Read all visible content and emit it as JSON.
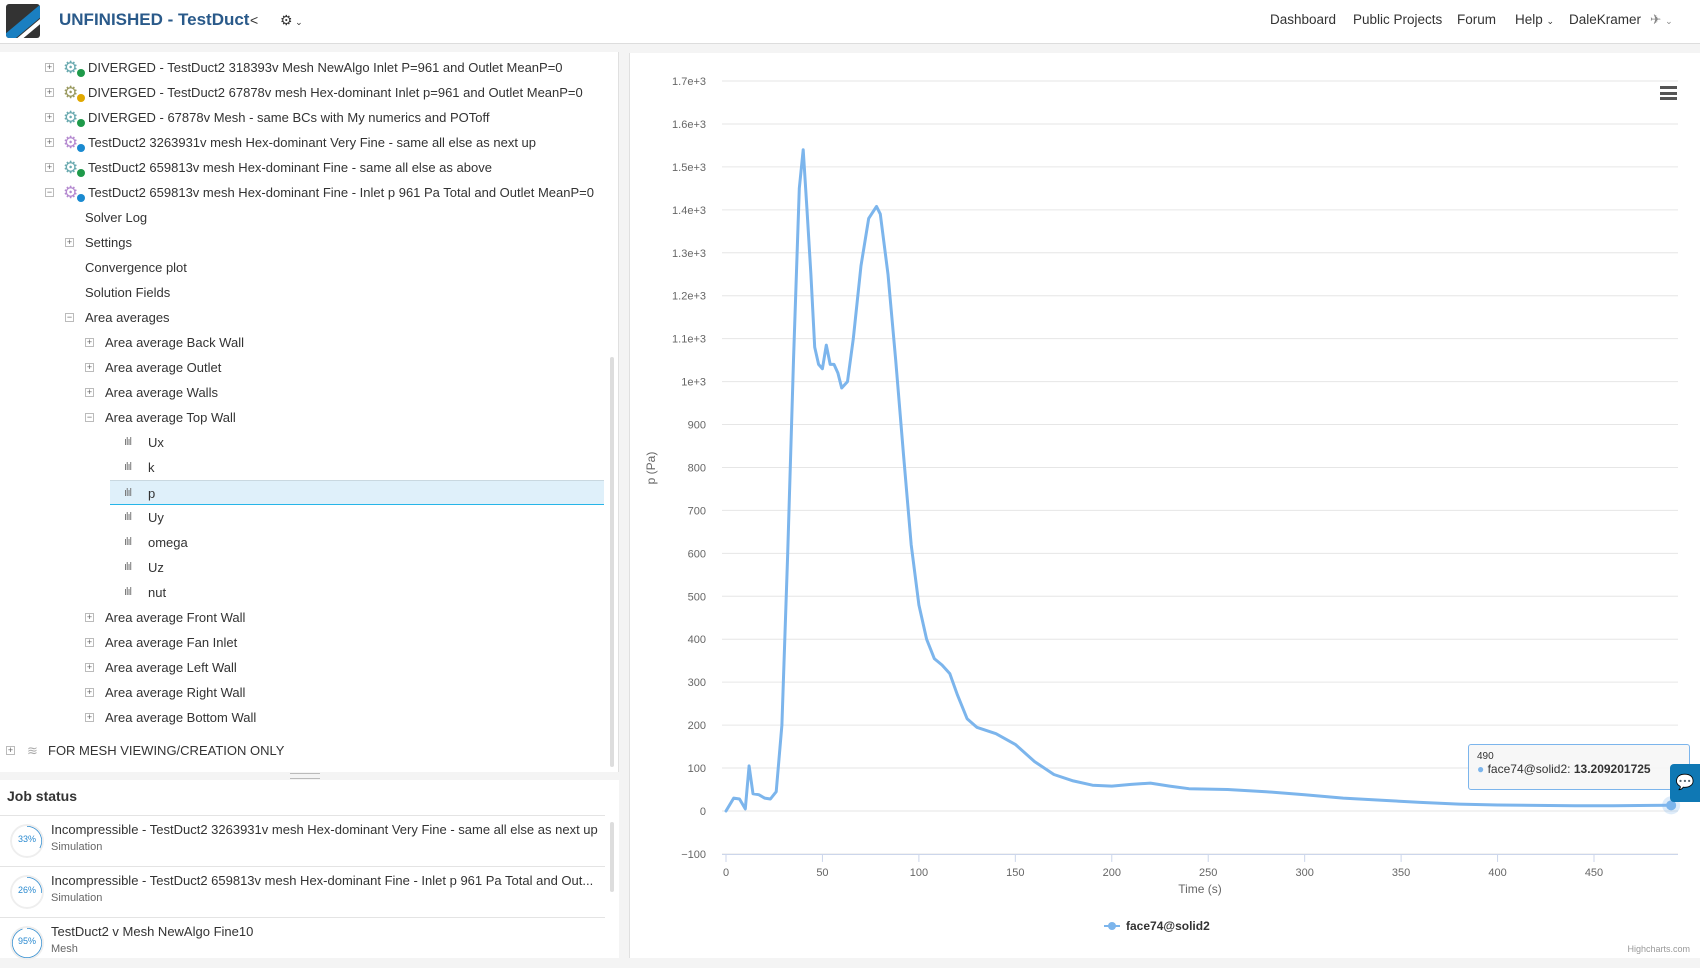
{
  "header": {
    "title": "UNFINISHED - TestDuct",
    "share_icon": "share-icon",
    "settings_icon": "gear-icon",
    "nav": [
      "Dashboard",
      "Public Projects",
      "Forum",
      "Help"
    ],
    "user": "DaleKramer"
  },
  "tree": {
    "simulations": [
      {
        "label": "DIVERGED - TestDuct2 318393v Mesh NewAlgo Inlet P=961 and Outlet MeanP=0",
        "status": "finished",
        "color": "#6aaab0",
        "badge": "#1e9a4a",
        "expanded": false
      },
      {
        "label": "DIVERGED - TestDuct2 67878v mesh Hex-dominant Inlet p=961 and Outlet MeanP=0",
        "status": "warning",
        "color": "#9a9a60",
        "badge": "#e0a800",
        "expanded": false
      },
      {
        "label": "DIVERGED - 67878v Mesh - same BCs with My numerics and POToff",
        "status": "finished",
        "color": "#6aaab0",
        "badge": "#1e9a4a",
        "expanded": false
      },
      {
        "label": "TestDuct2 3263931v mesh Hex-dominant Very Fine - same all else as next up",
        "status": "running",
        "color": "#b58ad0",
        "badge": "#1a8ad0",
        "expanded": false
      },
      {
        "label": "TestDuct2 659813v mesh Hex-dominant Fine - same all else as above",
        "status": "finished",
        "color": "#6aaab0",
        "badge": "#1e9a4a",
        "expanded": false
      },
      {
        "label": "TestDuct2 659813v mesh Hex-dominant Fine - Inlet p 961 Pa Total and Outlet MeanP=0",
        "status": "running",
        "color": "#b58ad0",
        "badge": "#1a8ad0",
        "expanded": true
      }
    ],
    "sim_children": [
      {
        "label": "Solver Log",
        "exp": ""
      },
      {
        "label": "Settings",
        "exp": "+"
      },
      {
        "label": "Convergence plot",
        "exp": ""
      },
      {
        "label": "Solution Fields",
        "exp": ""
      },
      {
        "label": "Area averages",
        "exp": "−"
      }
    ],
    "area_averages_before": [
      "Area average Back Wall",
      "Area average Outlet",
      "Area average Walls"
    ],
    "top_wall": "Area average Top Wall",
    "fields": [
      "Ux",
      "k",
      "p",
      "Uy",
      "omega",
      "Uz",
      "nut"
    ],
    "selected_field": "p",
    "area_averages_after": [
      "Area average Front Wall",
      "Area average Fan Inlet",
      "Area average Left Wall",
      "Area average Right Wall",
      "Area average Bottom Wall"
    ],
    "mesh_folder": "FOR MESH VIEWING/CREATION ONLY"
  },
  "jobs": {
    "title": "Job status",
    "items": [
      {
        "title": "Incompressible - TestDuct2 3263931v mesh Hex-dominant Very Fine - same all else as next up",
        "type": "Simulation",
        "progress": 33,
        "progress_label": "33%"
      },
      {
        "title": "Incompressible - TestDuct2 659813v mesh Hex-dominant Fine - Inlet p 961 Pa Total and Out...",
        "type": "Simulation",
        "progress": 26,
        "progress_label": "26%"
      },
      {
        "title": "TestDuct2 v Mesh NewAlgo Fine10",
        "type": "Mesh",
        "progress": 95,
        "progress_label": "95%"
      }
    ]
  },
  "chart_data": {
    "type": "line",
    "title": "",
    "xlabel": "Time (s)",
    "ylabel": "p (Pa)",
    "xlim": [
      0,
      490
    ],
    "ylim": [
      -100,
      1700
    ],
    "grid": true,
    "legend": "bottom-center",
    "xticks": [
      "0",
      "50",
      "100",
      "150",
      "200",
      "250",
      "300",
      "350",
      "400",
      "450"
    ],
    "yticks": [
      "−100",
      "0",
      "100",
      "200",
      "300",
      "400",
      "500",
      "600",
      "700",
      "800",
      "900",
      "1e+3",
      "1.1e+3",
      "1.2e+3",
      "1.3e+3",
      "1.4e+3",
      "1.5e+3",
      "1.6e+3",
      "1.7e+3"
    ],
    "color": "#7cb5ec",
    "series": [
      {
        "name": "face74@solid2",
        "x": [
          0,
          4,
          7,
          10,
          12,
          14,
          17,
          20,
          23,
          26,
          29,
          32,
          35,
          38,
          40,
          42,
          44,
          46,
          48,
          50,
          52,
          54,
          56,
          58,
          60,
          63,
          66,
          70,
          74,
          78,
          80,
          84,
          88,
          92,
          96,
          100,
          104,
          108,
          112,
          116,
          120,
          125,
          130,
          140,
          150,
          160,
          170,
          180,
          190,
          200,
          210,
          220,
          230,
          240,
          260,
          280,
          300,
          320,
          340,
          360,
          380,
          400,
          420,
          440,
          460,
          480,
          490
        ],
        "y": [
          0,
          30,
          28,
          5,
          105,
          40,
          38,
          30,
          28,
          45,
          200,
          600,
          1050,
          1450,
          1540,
          1400,
          1250,
          1080,
          1040,
          1030,
          1085,
          1040,
          1040,
          1020,
          985,
          1000,
          1100,
          1270,
          1380,
          1408,
          1390,
          1250,
          1050,
          830,
          620,
          480,
          400,
          355,
          340,
          320,
          270,
          215,
          195,
          180,
          155,
          115,
          85,
          70,
          60,
          58,
          62,
          65,
          58,
          52,
          50,
          45,
          38,
          30,
          25,
          20,
          16,
          14,
          13,
          12,
          12,
          13,
          13.2
        ]
      }
    ],
    "tooltip": {
      "x_label": "490",
      "series": "face74@solid2",
      "value": "13.209201725"
    },
    "credit": "Highcharts.com"
  }
}
